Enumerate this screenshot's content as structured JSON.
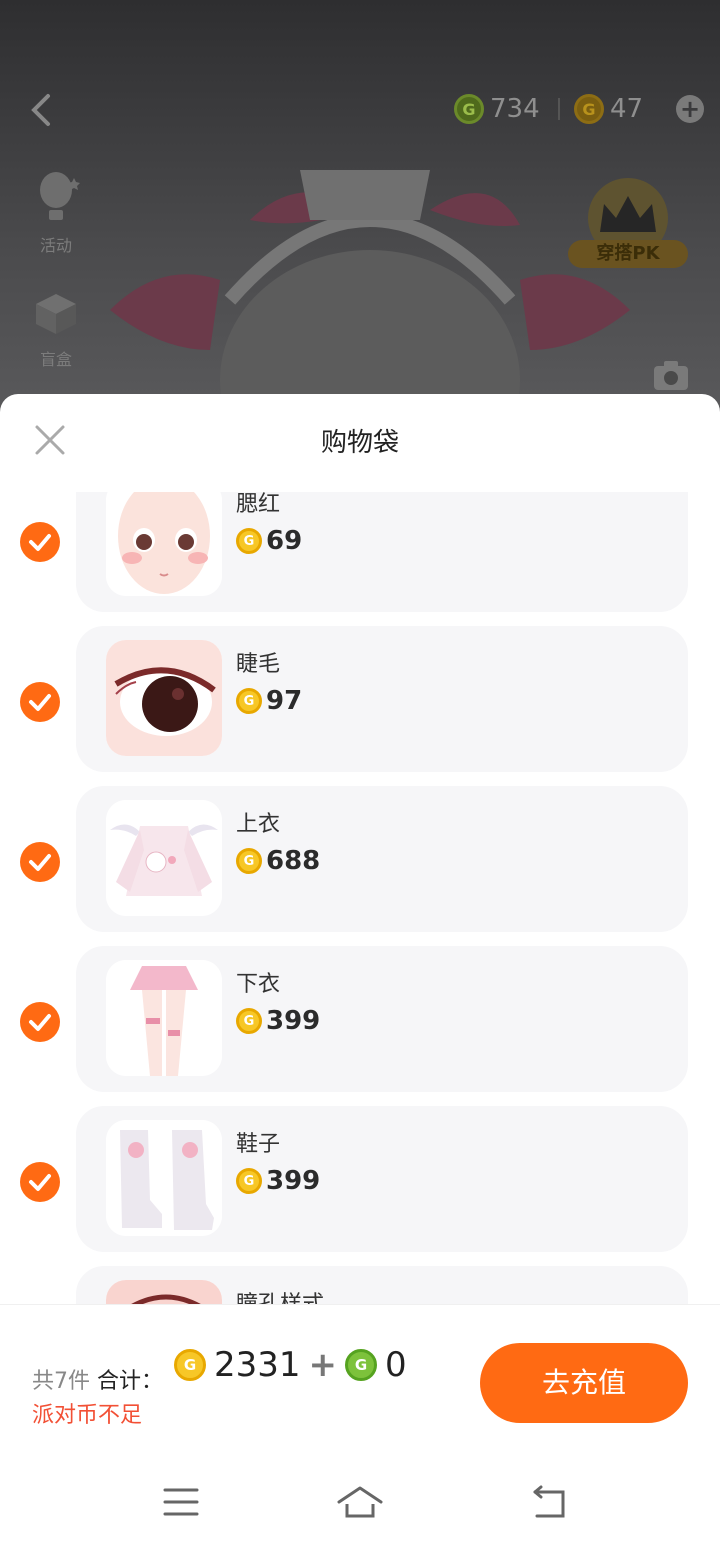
{
  "topbar": {
    "green_coins": "734",
    "party_coins": "47"
  },
  "side": {
    "activity_label": "活动",
    "blindbox_label": "盲盒",
    "pk_label": "穿搭PK"
  },
  "sheet": {
    "title": "购物袋",
    "items": [
      {
        "name": "腮红",
        "price": "69",
        "checked": true,
        "icon": "blush-face"
      },
      {
        "name": "睫毛",
        "price": "97",
        "checked": true,
        "icon": "eyelash-eye"
      },
      {
        "name": "上衣",
        "price": "688",
        "checked": true,
        "icon": "pink-top"
      },
      {
        "name": "下衣",
        "price": "399",
        "checked": true,
        "icon": "pink-skirt"
      },
      {
        "name": "鞋子",
        "price": "399",
        "checked": true,
        "icon": "white-boots"
      },
      {
        "name": "瞳孔样式",
        "price": "",
        "checked": true,
        "icon": "pupil-eye"
      }
    ]
  },
  "footer": {
    "count_text": "共7件",
    "total_label": "合计：",
    "party_total": "2331",
    "plus": "+",
    "green_total": "0",
    "warning": "派对币不足",
    "recharge_label": "去充值"
  },
  "colors": {
    "accent": "#ff6a13",
    "warning": "#f25035",
    "gold_coin": "#f7c727",
    "green_coin": "#7dc23b"
  }
}
